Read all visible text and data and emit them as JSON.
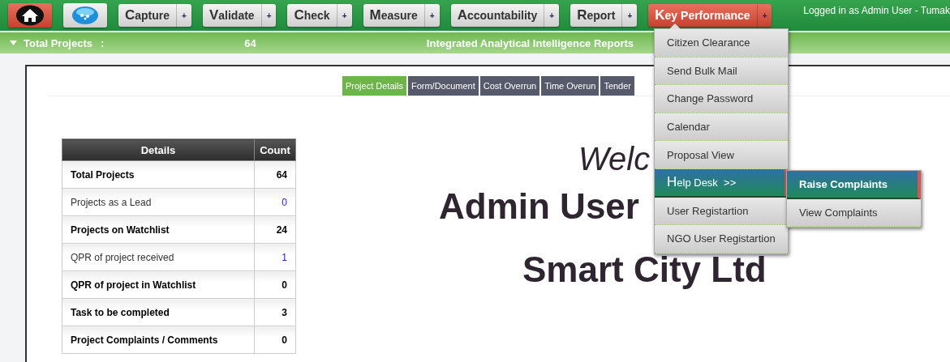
{
  "nav": {
    "items": [
      {
        "kind": "home",
        "selected": false
      },
      {
        "kind": "globe",
        "selected": false
      },
      {
        "kind": "menu",
        "label": "Capture",
        "selected": false
      },
      {
        "kind": "menu",
        "label": "Validate",
        "selected": false
      },
      {
        "kind": "menu",
        "label": "Check",
        "selected": false
      },
      {
        "kind": "menu",
        "label": "Measure",
        "selected": false
      },
      {
        "kind": "menu",
        "label": "Accountability",
        "selected": false
      },
      {
        "kind": "menu",
        "label": "Report",
        "selected": false
      },
      {
        "kind": "menu",
        "label": "Key Performance",
        "selected": true
      }
    ],
    "plus": "+",
    "login": "Logged in as Admin User - Tumak"
  },
  "summary_bar": {
    "label": "Total Projects",
    "separator": ":",
    "value": "64",
    "title": "Integrated Analytical Intelligence Reports"
  },
  "tabs": [
    {
      "label": "Project Details",
      "selected": true
    },
    {
      "label": "Form/Document",
      "selected": false
    },
    {
      "label": "Cost Overrun",
      "selected": false
    },
    {
      "label": "Time Overun",
      "selected": false
    },
    {
      "label": "Tender",
      "selected": false
    }
  ],
  "table": {
    "columns": [
      "Details",
      "Count"
    ],
    "rows": [
      {
        "label": "Total Projects",
        "count": "64",
        "link": false
      },
      {
        "label": "Projects as a Lead",
        "count": "0",
        "link": true
      },
      {
        "label": "Projects on Watchlist",
        "count": "24",
        "link": false
      },
      {
        "label": "QPR of project received",
        "count": "1",
        "link": true
      },
      {
        "label": "QPR of project in Watchlist",
        "count": "0",
        "link": false
      },
      {
        "label": "Task to be completed",
        "count": "3",
        "link": false
      },
      {
        "label": "Project Complaints / Comments",
        "count": "0",
        "link": false
      }
    ]
  },
  "welcome": {
    "greeting": "Welc",
    "name": "Admin User",
    "org": "Smart City Ltd"
  },
  "dropdown": {
    "items": [
      {
        "label": "Citizen Clearance",
        "selected": false
      },
      {
        "label": "Send Bulk Mail",
        "selected": false
      },
      {
        "label": "Change Password",
        "selected": false
      },
      {
        "label": "Calendar",
        "selected": false
      },
      {
        "label": "Proposal View",
        "selected": false
      },
      {
        "label": "Help Desk",
        "suffix": ">>",
        "selected": true
      },
      {
        "label": "User Registartion",
        "selected": false
      },
      {
        "label": "NGO User Registartion",
        "selected": false
      }
    ],
    "submenu": [
      {
        "label": "Raise Complaints",
        "selected": true
      },
      {
        "label": "View Complaints",
        "selected": false
      }
    ]
  }
}
